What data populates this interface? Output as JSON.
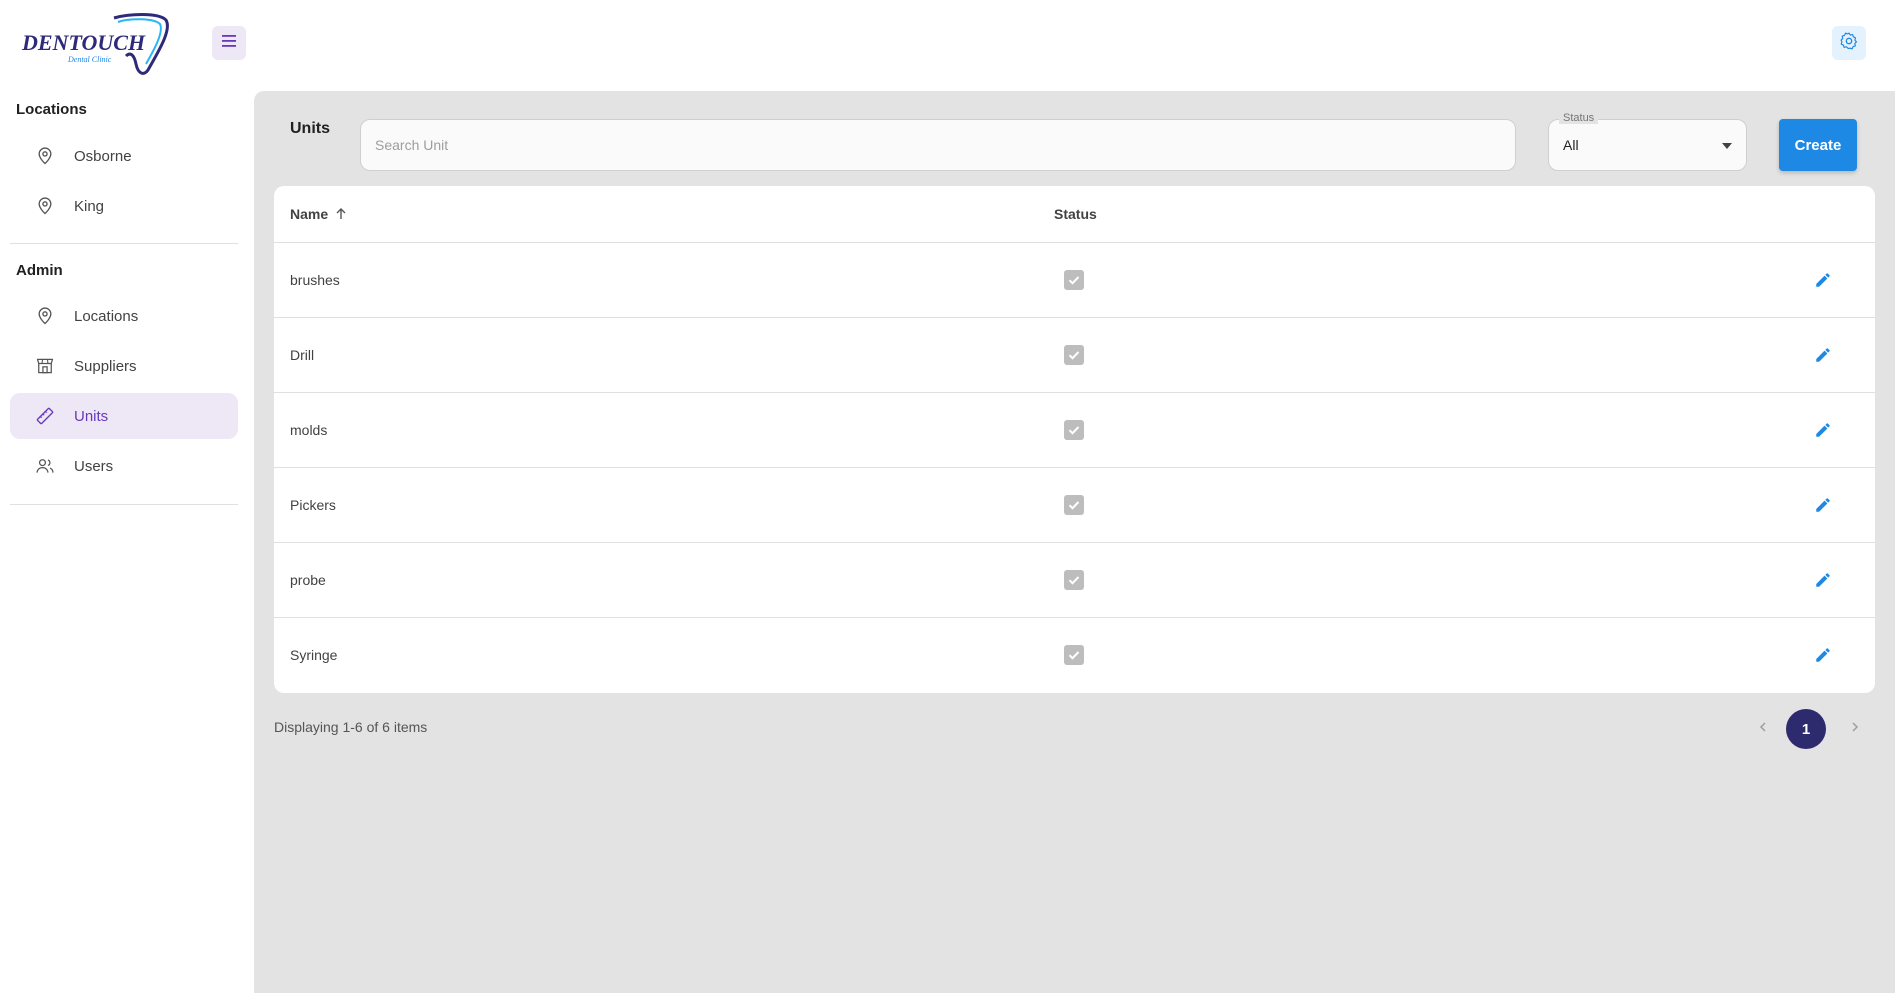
{
  "brand": {
    "logo_text": "DENTOUCH",
    "logo_subtext": "Dental Clinic"
  },
  "header": {
    "menu_icon": "hamburger-menu-icon",
    "settings_icon": "gear-icon"
  },
  "sidebar": {
    "sections": [
      {
        "heading": "Locations",
        "items": [
          {
            "label": "Osborne",
            "icon": "map-pin-icon"
          },
          {
            "label": "King",
            "icon": "map-pin-icon"
          }
        ]
      },
      {
        "heading": "Admin",
        "items": [
          {
            "label": "Locations",
            "icon": "map-pin-icon"
          },
          {
            "label": "Suppliers",
            "icon": "storefront-icon"
          },
          {
            "label": "Units",
            "icon": "ruler-icon",
            "active": true
          },
          {
            "label": "Users",
            "icon": "users-icon"
          }
        ]
      }
    ]
  },
  "main": {
    "title": "Units",
    "search": {
      "placeholder": "Search Unit",
      "value": ""
    },
    "status_filter": {
      "label": "Status",
      "value": "All",
      "options": [
        "All"
      ]
    },
    "create_label": "Create",
    "table": {
      "columns": [
        "Name",
        "Status"
      ],
      "sort": {
        "column": "Name",
        "direction": "asc"
      },
      "rows": [
        {
          "name": "brushes",
          "status_checked": true
        },
        {
          "name": "Drill",
          "status_checked": true
        },
        {
          "name": "molds",
          "status_checked": true
        },
        {
          "name": "Pickers",
          "status_checked": true
        },
        {
          "name": "probe",
          "status_checked": true
        },
        {
          "name": "Syringe",
          "status_checked": true
        }
      ]
    },
    "footer": {
      "display_text": "Displaying 1-6 of 6 items",
      "current_page": "1"
    }
  },
  "colors": {
    "accent_purple": "#673ab7",
    "primary_blue": "#1e88e5",
    "page_active": "#2e2a6e",
    "content_bg": "#e3e3e3"
  }
}
